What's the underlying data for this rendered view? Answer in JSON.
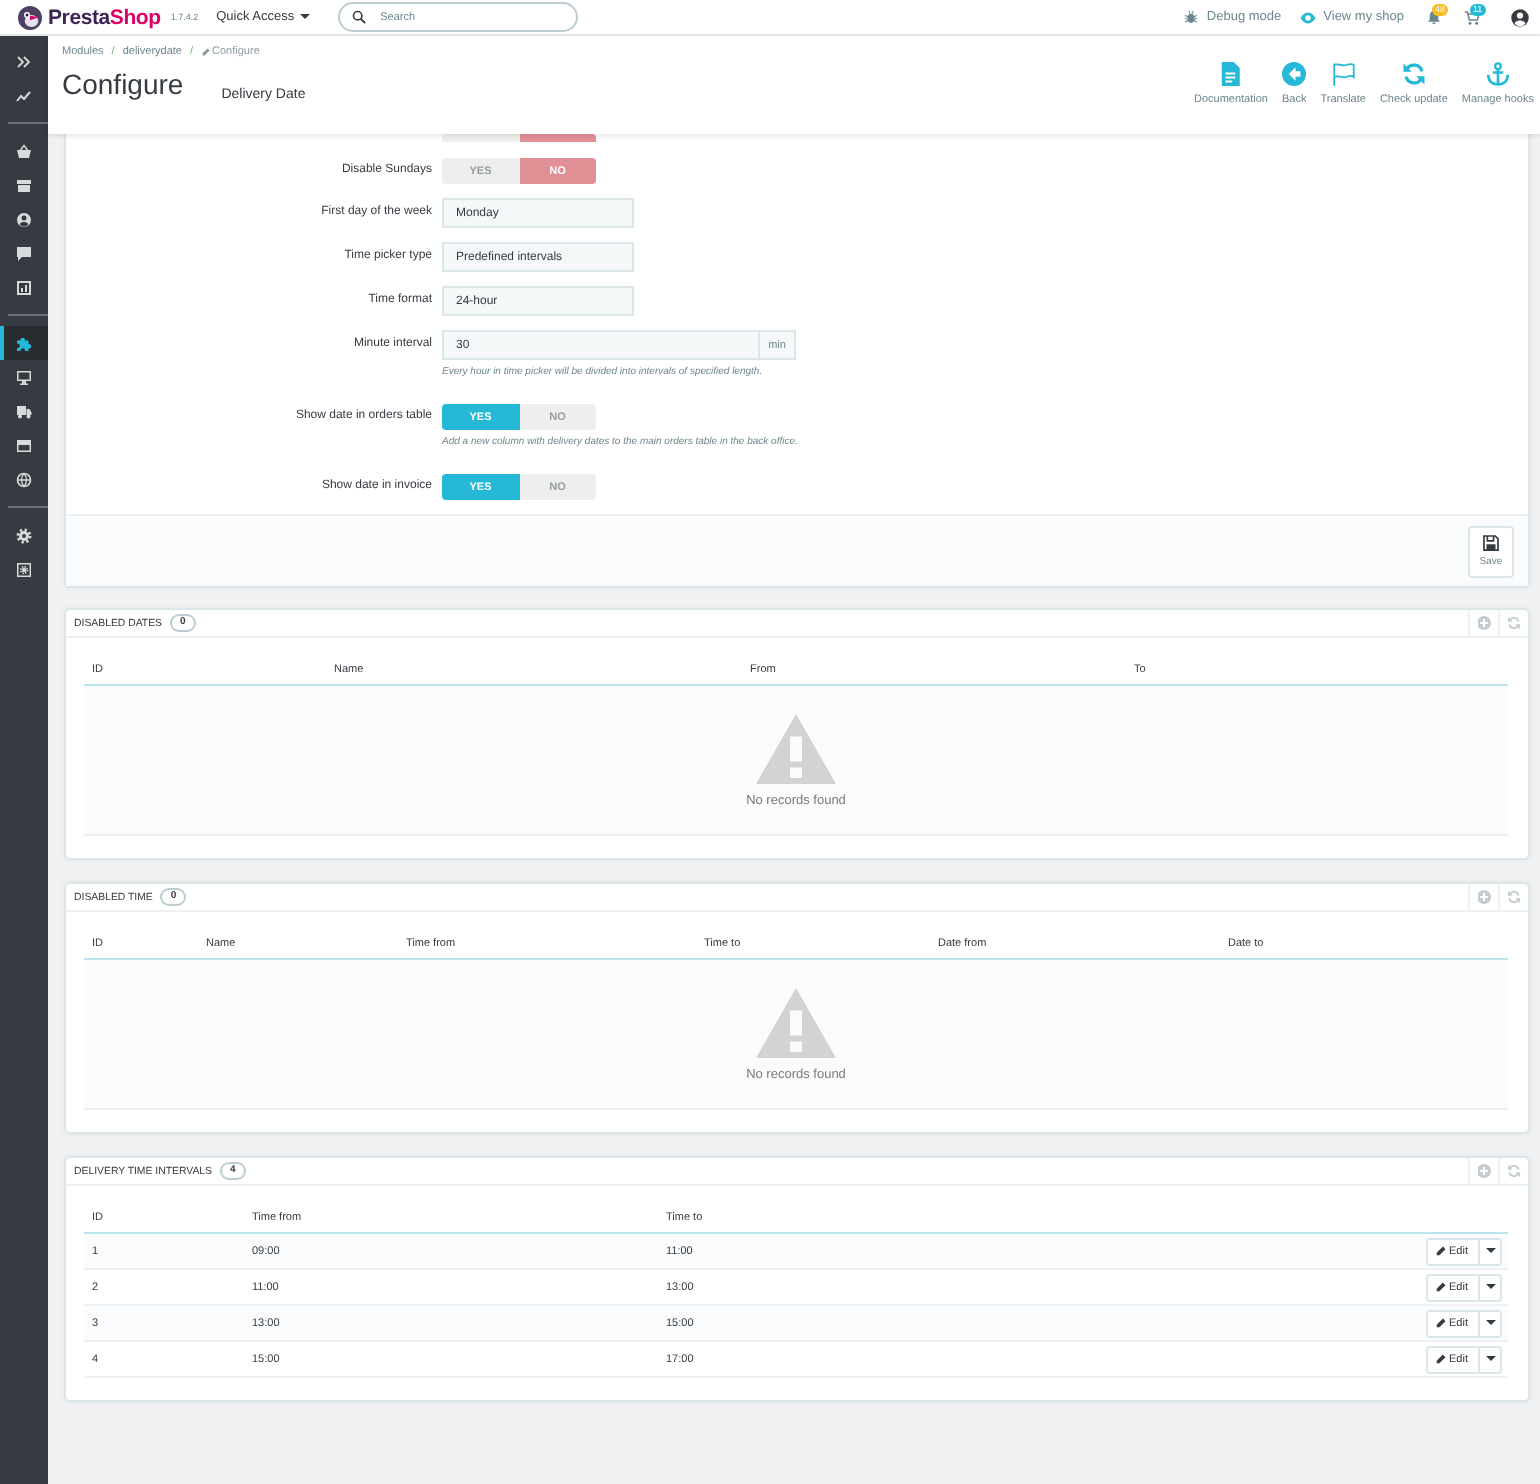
{
  "top_bar": {
    "logo_parts": [
      "Presta",
      "Shop"
    ],
    "version": "1.7.4.2",
    "quick_access": "Quick Access",
    "search": {
      "placeholder": "Search"
    },
    "debug_mode": "Debug mode",
    "view_shop": "View my shop",
    "notifications": [
      {
        "kind": "bell",
        "count": "48"
      },
      {
        "kind": "cart",
        "count": "11"
      }
    ]
  },
  "sidebar": {
    "groups": [
      {
        "items": [
          {
            "kind": "expand",
            "selected": false
          },
          {
            "kind": "stats",
            "selected": false
          }
        ]
      },
      {
        "items": [
          {
            "kind": "orders",
            "selected": false
          },
          {
            "kind": "catalog",
            "selected": false
          },
          {
            "kind": "customers",
            "selected": false
          },
          {
            "kind": "messages",
            "selected": false
          },
          {
            "kind": "reports",
            "selected": false
          }
        ]
      },
      {
        "items": [
          {
            "kind": "modules",
            "selected": true
          },
          {
            "kind": "design",
            "selected": false
          },
          {
            "kind": "shipping",
            "selected": false
          },
          {
            "kind": "payment",
            "selected": false
          },
          {
            "kind": "international",
            "selected": false
          }
        ]
      },
      {
        "items": [
          {
            "kind": "settings",
            "selected": false
          },
          {
            "kind": "advanced",
            "selected": false
          }
        ]
      }
    ]
  },
  "page_header": {
    "breadcrumb": [
      {
        "kind": "link",
        "text": "Modules"
      },
      {
        "kind": "link",
        "separator": "/",
        "text": "deliverydate"
      },
      {
        "kind": "current",
        "separator": "/",
        "text": "Configure"
      }
    ],
    "title": "Configure",
    "subtitle": "Delivery Date",
    "toolbar": [
      {
        "kind": "documentation",
        "label": "Documentation"
      },
      {
        "kind": "back",
        "label": "Back"
      },
      {
        "kind": "translate",
        "label": "Translate"
      },
      {
        "kind": "update",
        "label": "Check update"
      },
      {
        "kind": "hooks",
        "label": "Manage hooks"
      }
    ]
  },
  "settings_form": {
    "rows": [
      {
        "kind": "toggle_clipped",
        "options": [
          {
            "kind": "yes",
            "selected": false
          },
          {
            "kind": "no",
            "selected": true
          }
        ]
      },
      {
        "kind": "toggle",
        "label": "Disable Sundays",
        "options": [
          {
            "kind": "yes",
            "label": "YES",
            "selected": false
          },
          {
            "kind": "no",
            "label": "NO",
            "selected": true
          }
        ]
      },
      {
        "kind": "select",
        "label": "First day of the week",
        "value": "Monday"
      },
      {
        "kind": "select",
        "label": "Time picker type",
        "value": "Predefined intervals"
      },
      {
        "kind": "select",
        "label": "Time format",
        "value": "24-hour"
      },
      {
        "kind": "input",
        "label": "Minute interval",
        "value": "30",
        "suffix": "min",
        "help": "Every hour in time picker will be divided into intervals of specified length."
      },
      {
        "kind": "toggle",
        "label": "Show date in orders table",
        "options": [
          {
            "kind": "yes",
            "label": "YES",
            "selected": true
          },
          {
            "kind": "no",
            "label": "NO",
            "selected": false
          }
        ],
        "help": "Add a new column with delivery dates to the main orders table in the back office."
      },
      {
        "kind": "toggle",
        "label": "Show date in invoice",
        "options": [
          {
            "kind": "yes",
            "label": "YES",
            "selected": true
          },
          {
            "kind": "no",
            "label": "NO",
            "selected": false
          }
        ]
      }
    ],
    "save_label": "Save"
  },
  "list_panels": [
    {
      "title": "DISABLED DATES",
      "count": "0",
      "columns": [
        "ID",
        "Name",
        "From",
        "To"
      ],
      "empty_text": "No records found"
    },
    {
      "title": "DISABLED TIME",
      "count": "0",
      "columns": [
        "ID",
        "Name",
        "Time from",
        "Time to",
        "Date from",
        "Date to"
      ],
      "empty_text": "No records found"
    },
    {
      "title": "DELIVERY TIME INTERVALS",
      "count": "4",
      "columns": [
        "ID",
        "Time from",
        "Time to"
      ],
      "rows": [
        {
          "cells": [
            "1",
            "09:00",
            "11:00"
          ],
          "action": "Edit"
        },
        {
          "cells": [
            "2",
            "11:00",
            "13:00"
          ],
          "action": "Edit"
        },
        {
          "cells": [
            "3",
            "13:00",
            "15:00"
          ],
          "action": "Edit"
        },
        {
          "cells": [
            "4",
            "15:00",
            "17:00"
          ],
          "action": "Edit"
        }
      ]
    }
  ]
}
